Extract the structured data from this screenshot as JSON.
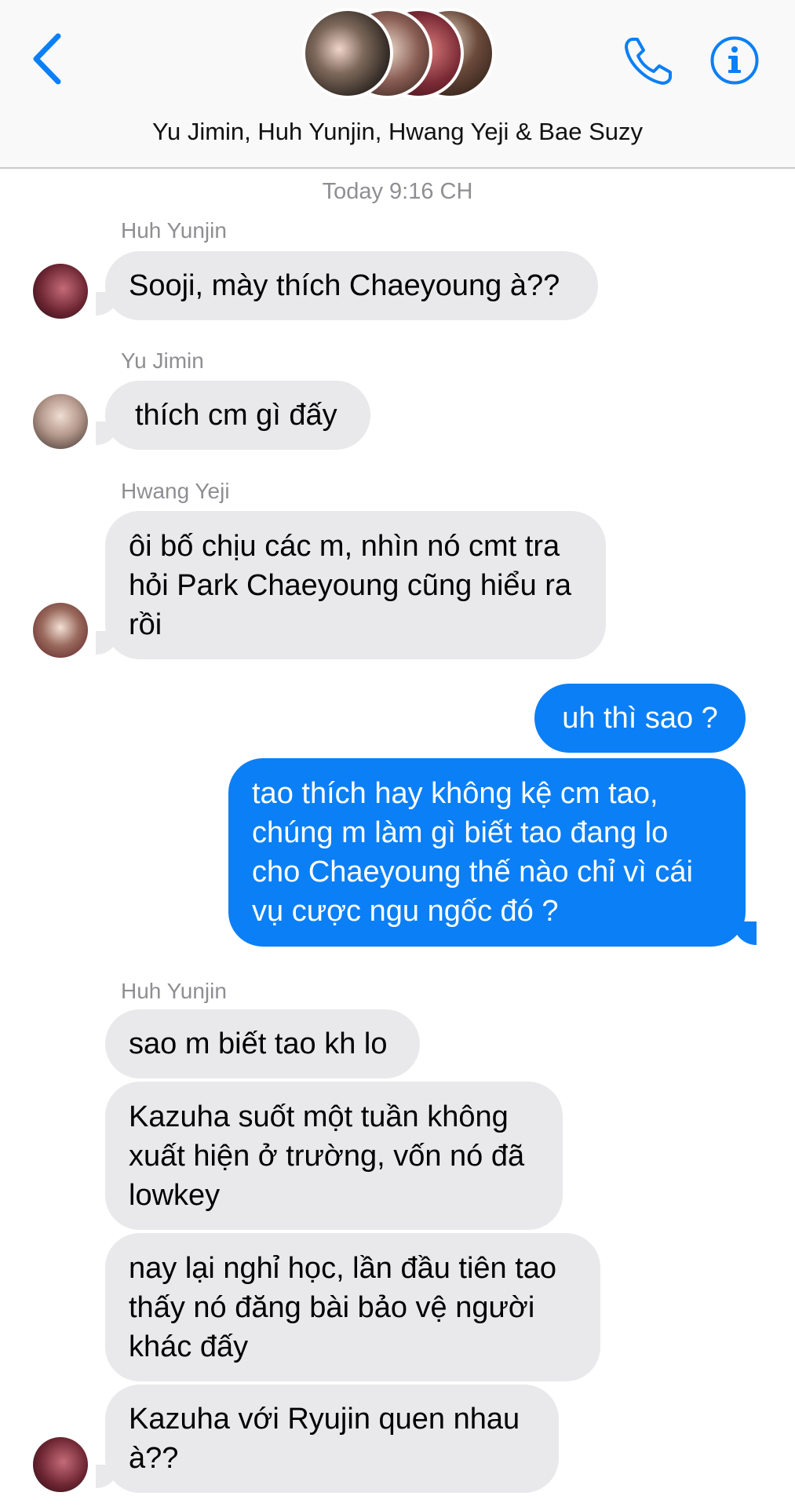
{
  "header": {
    "title": "Yu Jimin, Huh Yunjin, Hwang Yeji & Bae Suzy"
  },
  "timestamp": "Today 9:16 CH",
  "messages": [
    {
      "sender": "Huh Yunjin",
      "text": "Sooji, mày thích Chaeyoung à??"
    },
    {
      "sender": "Yu Jimin",
      "text": "thích cm gì đấy"
    },
    {
      "sender": "Hwang Yeji",
      "text": "ôi bố chịu các m, nhìn nó cmt tra hỏi Park Chaeyoung cũng hiểu ra rồi"
    },
    {
      "sender": "",
      "text": "uh thì sao ?"
    },
    {
      "sender": "",
      "text": "tao thích hay không kệ cm tao, chúng m làm gì biết tao đang lo cho Chaeyoung thế nào chỉ vì cái vụ cược ngu ngốc đó ?"
    },
    {
      "sender": "Huh Yunjin",
      "text": "sao m biết tao kh lo"
    },
    {
      "sender": "",
      "text": "Kazuha suốt một tuần không xuất hiện ở trường, vốn nó đã lowkey"
    },
    {
      "sender": "",
      "text": "nay lại nghỉ học, lần đầu tiên tao thấy nó đăng bài bảo vệ người khác đấy"
    },
    {
      "sender": "",
      "text": "Kazuha với Ryujin quen nhau à??"
    }
  ],
  "colors": {
    "accent": "#0b7ff6",
    "incoming_bubble": "#e9e9eb",
    "meta_text": "#8e8e93"
  },
  "icons": {
    "back": "chevron-left-icon",
    "call": "phone-icon",
    "info": "info-icon"
  }
}
